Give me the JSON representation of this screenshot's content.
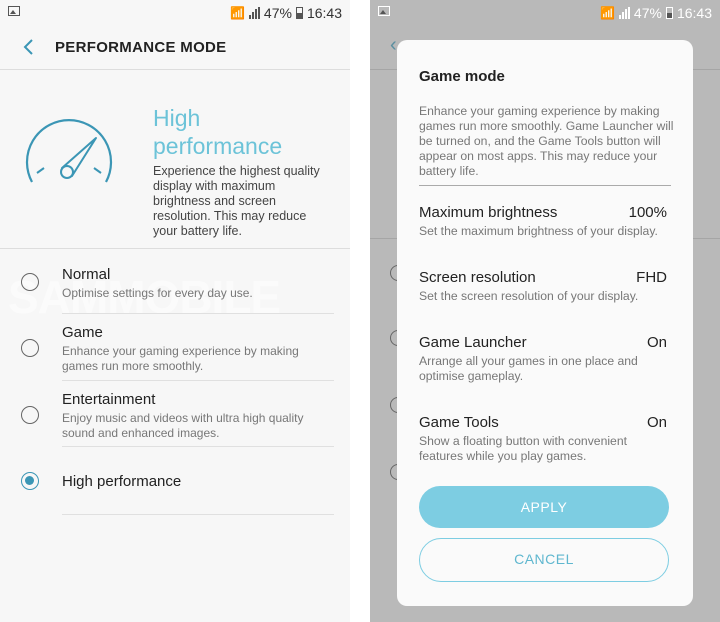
{
  "status_bar": {
    "battery": "47%",
    "time": "16:43"
  },
  "left": {
    "title": "PERFORMANCE MODE",
    "hero": {
      "title": "High performance",
      "description": "Experience the highest quality display with maximum brightness and screen resolution. This may reduce your battery life."
    },
    "options": [
      {
        "title": "Normal",
        "description": "Optimise settings for every day use.",
        "selected": false
      },
      {
        "title": "Game",
        "description": "Enhance your gaming experience by making games run more smoothly.",
        "selected": false
      },
      {
        "title": "Entertainment",
        "description": "Enjoy music and videos with ultra high quality sound and enhanced images.",
        "selected": false
      },
      {
        "title": "High performance",
        "description": "",
        "selected": true
      }
    ],
    "watermark": "SAMMOBILE"
  },
  "dialog": {
    "title": "Game mode",
    "description": "Enhance your gaming experience by making games run more smoothly. Game Launcher will be turned on, and the Game Tools button will appear on most apps. This may reduce your battery life.",
    "rows": [
      {
        "title": "Maximum brightness",
        "value": "100%",
        "description": "Set the maximum brightness of your display."
      },
      {
        "title": "Screen resolution",
        "value": "FHD",
        "description": "Set the screen resolution of your display."
      },
      {
        "title": "Game Launcher",
        "value": "On",
        "description": "Arrange all your games in one place and optimise gameplay."
      },
      {
        "title": "Game Tools",
        "value": "On",
        "description": "Show a floating button with convenient features while you play games."
      }
    ],
    "apply_label": "APPLY",
    "cancel_label": "CANCEL"
  },
  "colors": {
    "accent": "#3b96b5",
    "hero_text": "#6cc3d8",
    "button": "#7dcde2"
  }
}
